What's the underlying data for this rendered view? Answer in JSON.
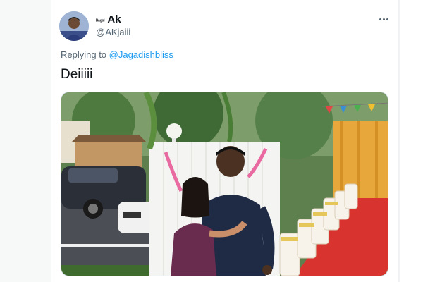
{
  "tweet": {
    "author": {
      "name_prefix": "ᴮᵃᵍᵒˡ",
      "display_name": "Ak",
      "handle": "@AKjaiii"
    },
    "replying_to_label": "Replying to",
    "replying_to_mention": "@Jagadishbliss",
    "text": "Deiiiii"
  },
  "icons": {
    "more": "more-horizontal-icon",
    "avatar": "user-avatar"
  },
  "colors": {
    "link": "#1d9bf0",
    "secondary_text": "#536471",
    "primary_text": "#0f1419"
  }
}
